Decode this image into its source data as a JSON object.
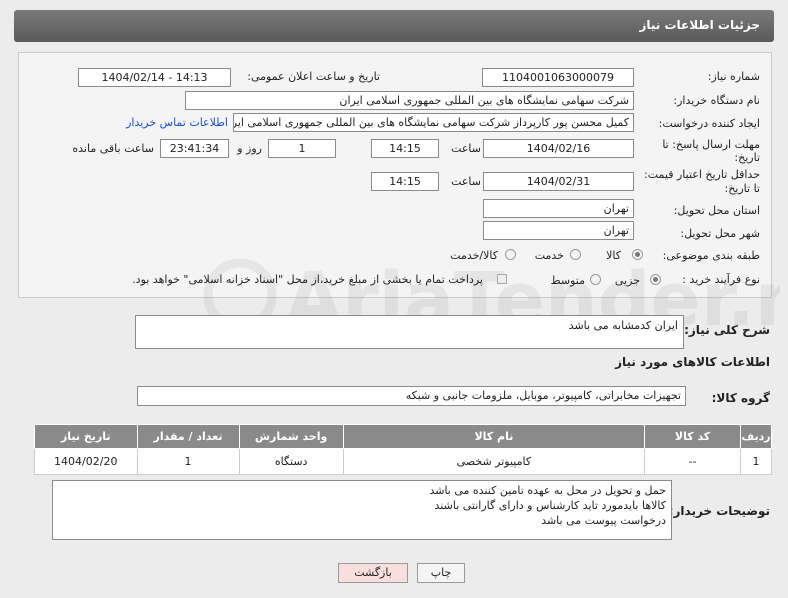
{
  "header": {
    "title": "جزئیات اطلاعات نیاز"
  },
  "need_number": {
    "label": "شماره نیاز:",
    "value": "1104001063000079"
  },
  "announce_datetime": {
    "label": "تاریخ و ساعت اعلان عمومی:",
    "value": "1404/02/14 - 14:13"
  },
  "buyer_org": {
    "label": "نام دستگاه خریدار:",
    "value": "شرکت سهامی نمایشگاه های بین المللی جمهوری اسلامی ایران"
  },
  "creator": {
    "label": "ایجاد کننده درخواست:",
    "value": "کمیل محسن پور کارپرداز شرکت سهامی نمایشگاه های بین المللی جمهوری اسلامی ایران",
    "contact_link": "اطلاعات تماس خریدار"
  },
  "response_deadline": {
    "label_line1": "مهلت ارسال پاسخ: تا",
    "label_line2": "تاریخ:",
    "date": "1404/02/16",
    "time_label": "ساعت",
    "time": "14:15",
    "days": "1",
    "days_label": "روز و",
    "remaining": "23:41:34",
    "remaining_label": "ساعت باقی مانده"
  },
  "price_validity": {
    "label_line1": "حداقل تاریخ اعتبار قیمت:",
    "label_line2": "تا تاریخ:",
    "date": "1404/02/31",
    "time_label": "ساعت",
    "time": "14:15"
  },
  "delivery_province": {
    "label": "استان محل تحویل:",
    "value": "تهران"
  },
  "delivery_city": {
    "label": "شهر محل تحویل:",
    "value": "تهران"
  },
  "category": {
    "label": "طبقه بندی موضوعی:",
    "options": [
      "کالا",
      "خدمت",
      "کالا/خدمت"
    ],
    "selected": "کالا"
  },
  "purchase_process": {
    "label": "نوع فرآیند خرید :",
    "options": [
      "جزیی",
      "متوسط"
    ],
    "selected": "جزیی",
    "payment_note": "پرداخت تمام یا بخشی از مبلغ خرید،از محل \"اسناد خزانه اسلامی\" خواهد بود."
  },
  "description": {
    "label": "شرح کلی نیاز:",
    "value": "ایران کدمشابه می باشد"
  },
  "items_section_title": "اطلاعات کالاهای مورد نیاز",
  "goods_group": {
    "label": "گروه کالا:",
    "value": "تجهیزات مخابراتی، کامپیوتر، موبایل، ملزومات جانبی و شبکه"
  },
  "table": {
    "headers": [
      "ردیف",
      "کد کالا",
      "نام کالا",
      "واحد شمارش",
      "تعداد / مقدار",
      "تاریخ نیاز"
    ],
    "rows": [
      [
        "1",
        "--",
        "کامپیوتر شخصی",
        "دستگاه",
        "1",
        "1404/02/20"
      ]
    ]
  },
  "buyer_notes": {
    "label": "توضیحات خریدار:",
    "lines": [
      "حمل و تحویل در محل به عهده تامین کننده می باشد",
      "کالاها بایدمورد تاید کارشناس و دارای گارانتی باشند",
      "درخواست پیوست می باشد"
    ]
  },
  "buttons": {
    "print": "چاپ",
    "back": "بازگشت"
  },
  "watermark": {
    "text": "AriaTender.net"
  },
  "colors": {
    "header_bg": "#6a6a6a",
    "link": "#1a4ec9",
    "back_btn_bg": "#f9dede",
    "table_header_bg": "#8a8a8a"
  }
}
